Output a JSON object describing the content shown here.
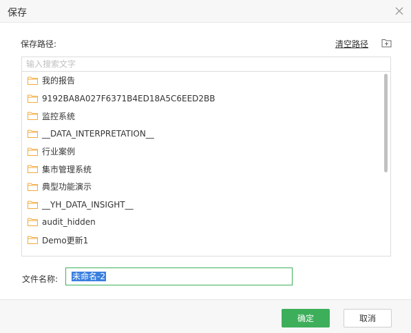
{
  "dialog": {
    "title": "保存",
    "close_icon": "close-icon"
  },
  "path": {
    "label": "保存路径:",
    "clear_label": "清空路径",
    "new_folder_icon": "new-folder-icon"
  },
  "search": {
    "placeholder": "输入搜索文字",
    "value": ""
  },
  "folders": [
    {
      "label": "我的报告",
      "icon": "folder-icon"
    },
    {
      "label": "9192BA8A027F6371B4ED18A5C6EED2BB",
      "icon": "folder-icon"
    },
    {
      "label": "监控系统",
      "icon": "folder-icon"
    },
    {
      "label": "__DATA_INTERPRETATION__",
      "icon": "folder-icon"
    },
    {
      "label": "行业案例",
      "icon": "folder-icon"
    },
    {
      "label": "集市管理系统",
      "icon": "folder-icon"
    },
    {
      "label": "典型功能演示",
      "icon": "folder-icon"
    },
    {
      "label": "__YH_DATA_INSIGHT__",
      "icon": "folder-icon"
    },
    {
      "label": "audit_hidden",
      "icon": "folder-icon"
    },
    {
      "label": "Demo更新1",
      "icon": "folder-icon"
    }
  ],
  "filename": {
    "label": "文件名称:",
    "value": "未命名-2"
  },
  "footer": {
    "ok_label": "确定",
    "cancel_label": "取消"
  },
  "colors": {
    "accent": "#3daf5a",
    "folder": "#f2a93b",
    "selection": "#3a7fe0"
  }
}
